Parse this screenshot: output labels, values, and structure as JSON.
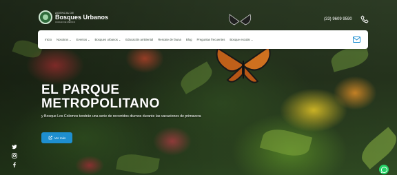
{
  "brand": {
    "name_small": "AGENCIA DE",
    "name_big": "Bosques Urbanos",
    "tagline": "CIUDAD DE MÉXICO"
  },
  "contact": {
    "phone": "(33) 9609 9590"
  },
  "nav": {
    "items": [
      {
        "label": "Inicio",
        "dropdown": false
      },
      {
        "label": "Nosotros",
        "dropdown": true
      },
      {
        "label": "Eventos",
        "dropdown": true
      },
      {
        "label": "Bosques urbanos",
        "dropdown": true
      },
      {
        "label": "Educación ambiental",
        "dropdown": false
      },
      {
        "label": "Rescate de fauna",
        "dropdown": false
      },
      {
        "label": "Blog",
        "dropdown": false
      },
      {
        "label": "Preguntas frecuentes",
        "dropdown": false
      },
      {
        "label": "Bosque escolar",
        "dropdown": true
      }
    ]
  },
  "hero": {
    "title_line1": "EL PARQUE",
    "title_line2": "METROPOLITANO",
    "subtitle": "y Bosque Los Colomos tendrán una serie de recorridos diurnos durante las vacaciones de primavera",
    "cta_label": "Ver más"
  },
  "colors": {
    "accent": "#1e8fd0",
    "whatsapp": "#25d366",
    "nav_bg": "#ffffff"
  },
  "icons": [
    "phone-icon",
    "mail-icon",
    "twitter-icon",
    "instagram-icon",
    "facebook-icon",
    "whatsapp-icon",
    "external-link-icon"
  ]
}
